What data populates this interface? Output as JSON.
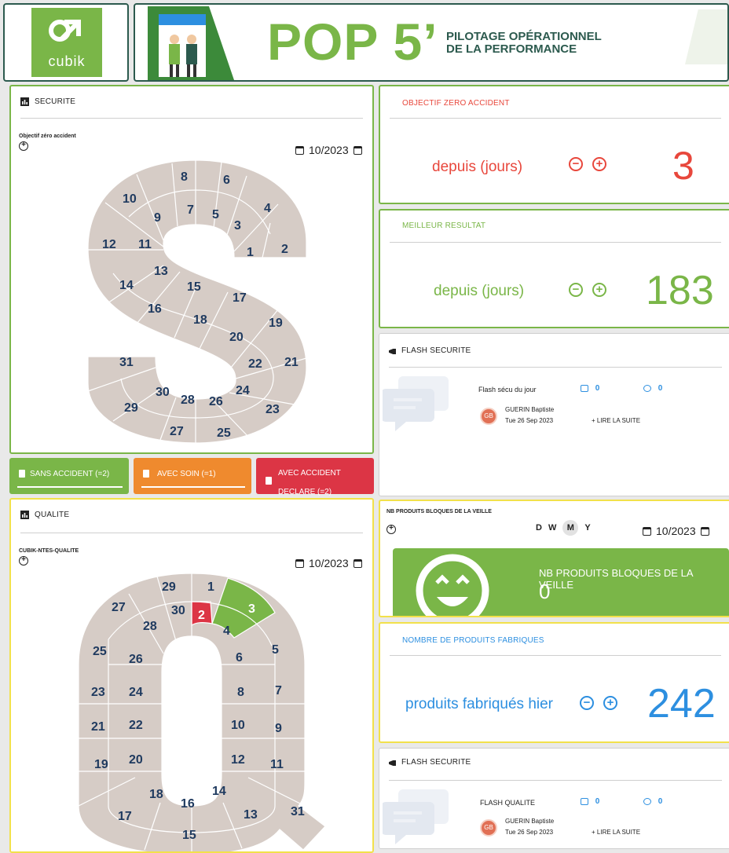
{
  "header": {
    "logo_text": "cubik",
    "pop_title": "POP 5’",
    "subtitle_line1": "PILOTAGE OPÉRATIONNEL",
    "subtitle_line2": "DE LA PERFORMANCE"
  },
  "securite": {
    "title": "SECURITE",
    "subtitle": "Objectif zéro accident",
    "date": "10/2023",
    "days": [
      "1",
      "2",
      "3",
      "4",
      "5",
      "6",
      "7",
      "8",
      "9",
      "10",
      "11",
      "12",
      "13",
      "14",
      "15",
      "16",
      "17",
      "18",
      "19",
      "20",
      "21",
      "22",
      "23",
      "24",
      "25",
      "26",
      "27",
      "28",
      "29",
      "30",
      "31"
    ]
  },
  "legend": {
    "sans_accident": "SANS ACCIDENT (=2)",
    "avec_soin": "AVEC SOIN (=1)",
    "avec_accident_l1": "AVEC ACCIDENT",
    "avec_accident_l2": "DECLARE (=2)",
    "colors": {
      "green": "#7ab648",
      "orange": "#ef8a2e",
      "red": "#dc3545"
    }
  },
  "objectif_zero": {
    "title": "OBJECTIF ZERO ACCIDENT",
    "label": "depuis (jours)",
    "value": "3",
    "color": "#e8473c"
  },
  "meilleur": {
    "title": "MEILLEUR RESULTAT",
    "label": "depuis (jours)",
    "value": "183",
    "color": "#7ab648"
  },
  "flash_securite": {
    "title": "FLASH SECURITE",
    "post_title": "Flash sécu du jour",
    "likes": "0",
    "comments": "0",
    "author": "GUERIN Baptiste",
    "date": "Tue 26 Sep 2023",
    "read_more": "+ LIRE LA SUITE",
    "initials": "GB"
  },
  "qualite": {
    "title": "QUALITE",
    "subtitle": "CUBIK-NTES-QUALITE",
    "date": "10/2023"
  },
  "produits_bloques": {
    "title": "NB PRODUITS BLOQUES DE LA VEILLE",
    "periods": [
      "D",
      "W",
      "M",
      "Y"
    ],
    "selected_period": "M",
    "date": "10/2023",
    "card_title": "NB PRODUITS BLOQUES DE LA VEILLE",
    "value": "0"
  },
  "produits_fabriques": {
    "title": "NOMBRE DE PRODUITS FABRIQUES",
    "label": "produits fabriqués hier",
    "value": "242",
    "color": "#2d8fe0"
  },
  "flash_qualite": {
    "title": "FLASH SECURITE",
    "post_title": "FLASH QUALITE",
    "likes": "0",
    "comments": "0",
    "author": "GUERIN Baptiste",
    "date": "Tue 26 Sep 2023",
    "read_more": "+ LIRE LA SUITE",
    "initials": "GB"
  }
}
